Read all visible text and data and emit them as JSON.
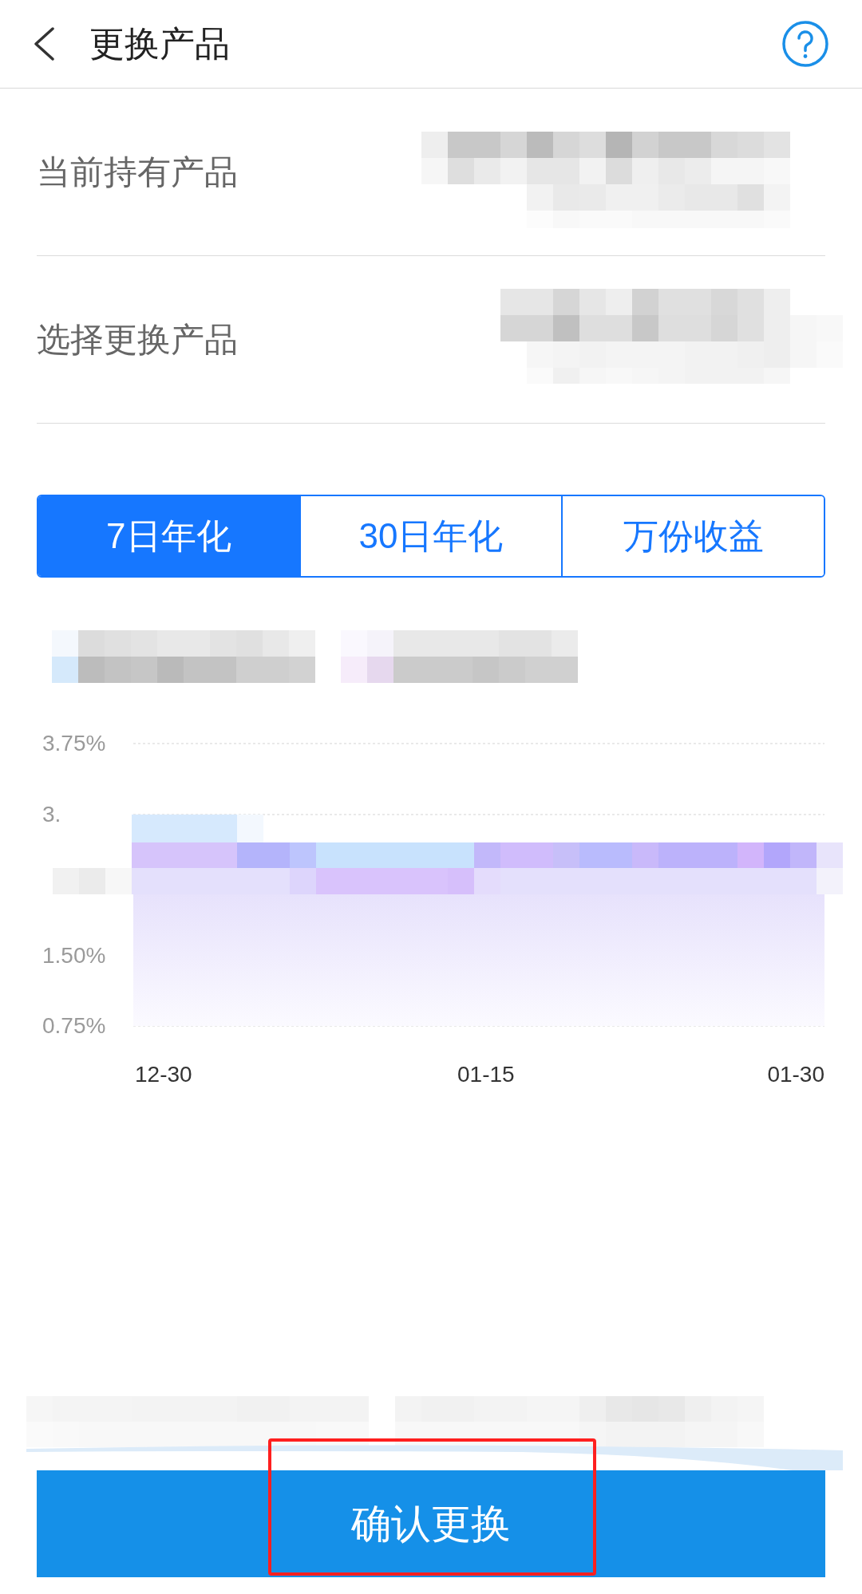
{
  "header": {
    "title": "更换产品"
  },
  "fields": [
    {
      "label": "当前持有产品"
    },
    {
      "label": "选择更换产品"
    }
  ],
  "tabs": [
    {
      "label": "7日年化",
      "selected": true
    },
    {
      "label": "30日年化",
      "selected": false
    },
    {
      "label": "万份收益",
      "selected": false
    }
  ],
  "chart": {
    "y_axis_labels": [
      "3.75%",
      "3.",
      "1.50%",
      "0.75%"
    ],
    "x_axis_labels": [
      "12-30",
      "01-15",
      "01-30"
    ]
  },
  "confirm_button": {
    "label": "确认更换",
    "highlighted": true
  }
}
